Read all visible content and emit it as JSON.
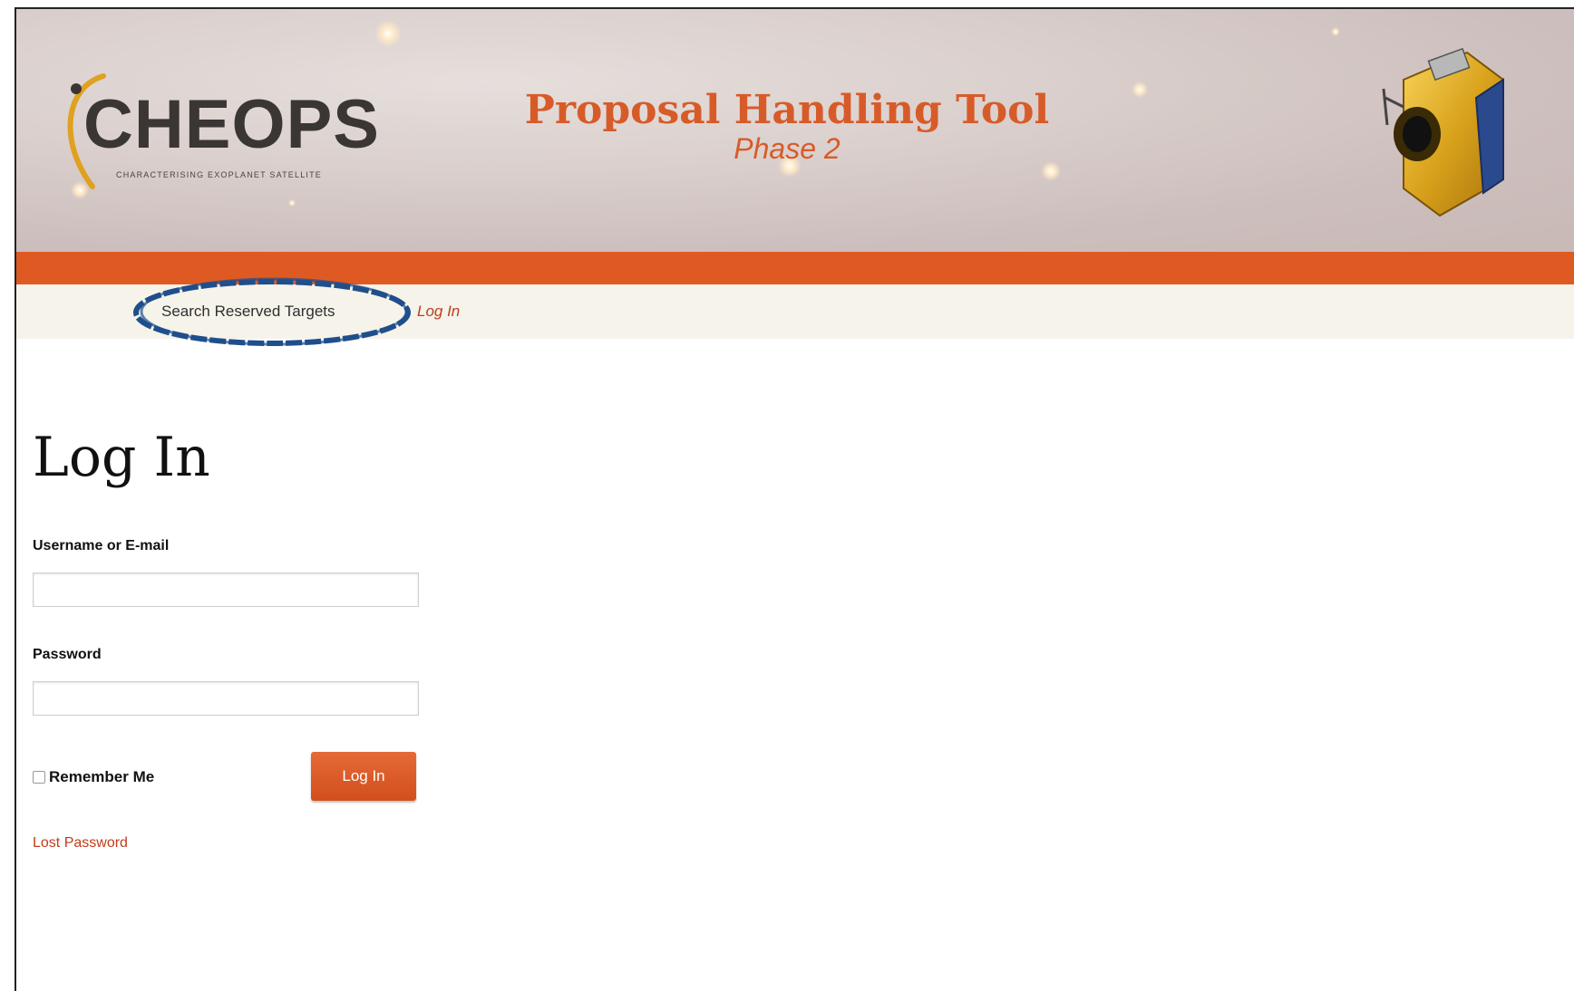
{
  "header": {
    "logo_text": "CHEOPS",
    "logo_subtitle": "CHARACTERISING EXOPLANET SATELLITE",
    "app_title": "Proposal Handling Tool",
    "app_subtitle": "Phase 2"
  },
  "nav": {
    "items": [
      {
        "label": "Search Reserved Targets"
      },
      {
        "label": "Log In"
      }
    ]
  },
  "form": {
    "page_title": "Log In",
    "username_label": "Username or E-mail",
    "username_value": "",
    "password_label": "Password",
    "password_value": "",
    "remember_label": "Remember Me",
    "remember_checked": false,
    "submit_label": "Log In",
    "lost_password_label": "Lost Password"
  },
  "colors": {
    "accent": "#df5a23",
    "nav_background": "#f5f3ea",
    "highlight": "#1f4e8c"
  }
}
